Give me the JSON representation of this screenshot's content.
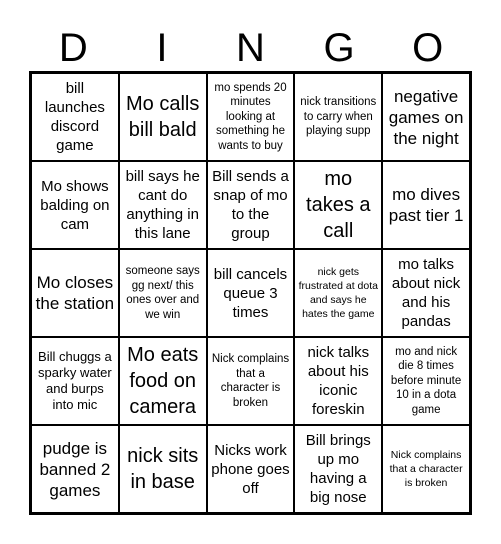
{
  "header": {
    "letters": [
      "D",
      "I",
      "N",
      "G",
      "O"
    ]
  },
  "board": {
    "cells": [
      [
        "bill launches discord game",
        "Mo calls bill bald",
        "mo spends 20 minutes looking at something he wants to buy",
        "nick transitions to carry when playing supp",
        "negative games on the night"
      ],
      [
        "Mo shows balding on cam",
        "bill says he cant do anything in this lane",
        "Bill sends a snap of mo to the group",
        "mo takes a call",
        "mo dives past tier 1"
      ],
      [
        "Mo closes the station",
        "someone says gg next/ this ones over and we win",
        "bill cancels queue 3 times",
        "nick gets frustrated at dota and says he hates the game",
        "mo talks about nick and his pandas"
      ],
      [
        "Bill chuggs a sparky water and burps into mic",
        "Mo eats food on camera",
        "Nick complains that a character is broken",
        "nick talks about his iconic foreskin",
        "mo and nick die 8 times before minute 10 in a dota game"
      ],
      [
        "pudge is banned 2 games",
        "nick sits in base",
        "Nicks work phone goes off",
        "Bill brings up mo having a big nose",
        "Nick complains that a character is broken"
      ]
    ]
  }
}
